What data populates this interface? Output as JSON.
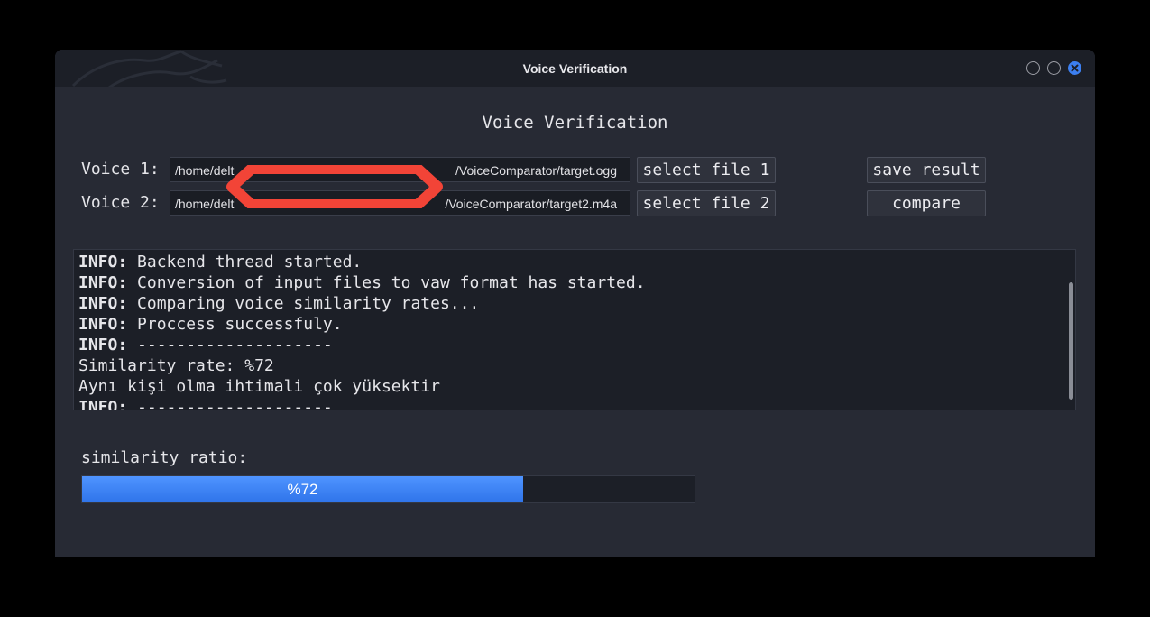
{
  "window": {
    "title": "Voice Verification"
  },
  "form": {
    "heading": "Voice Verification",
    "voice1_label": "Voice 1:",
    "voice2_label": "Voice 2:",
    "voice1_path_start": "/home/delt",
    "voice1_path_end": "/VoiceComparator/target.ogg",
    "voice2_path_start": "/home/delt",
    "voice2_path_end": "/VoiceComparator/target2.m4a",
    "select_file1_label": "select file 1",
    "select_file2_label": "select file 2",
    "save_result_label": "save result",
    "compare_label": "compare"
  },
  "log": {
    "lines": [
      {
        "prefix": "INFO:",
        "text": " Backend thread started."
      },
      {
        "prefix": "INFO:",
        "text": " Conversion of input files to vaw format has started."
      },
      {
        "prefix": "INFO:",
        "text": " Comparing voice similarity rates..."
      },
      {
        "prefix": "INFO:",
        "text": " Proccess successfuly."
      },
      {
        "prefix": "INFO:",
        "text": " --------------------"
      },
      {
        "prefix": "",
        "text": "Similarity rate: %72"
      },
      {
        "prefix": "",
        "text": "Aynı kişi olma ihtimali çok yüksektir"
      },
      {
        "prefix": "INFO:",
        "text": " --------------------"
      }
    ]
  },
  "similarity": {
    "label": "similarity ratio:",
    "percent_text": "%72",
    "value": 72
  },
  "colors": {
    "accent": "#3c7ff0",
    "redaction": "#f24437",
    "window_bg": "#272a34"
  }
}
